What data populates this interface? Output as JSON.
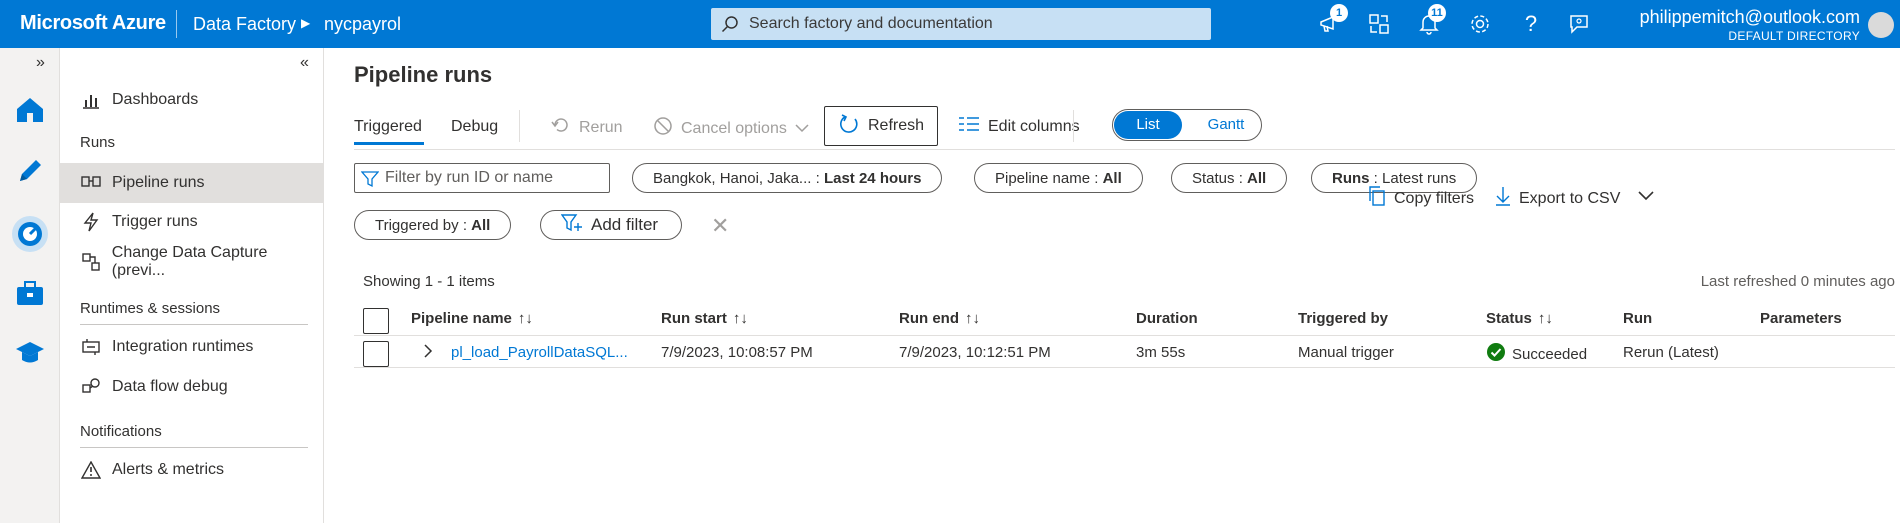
{
  "topbar": {
    "brand": "Microsoft Azure",
    "breadcrumb": [
      "Data Factory",
      "nycpayrol"
    ],
    "search_placeholder": "Search factory and documentation",
    "announcement_count": "1",
    "notification_count": "11",
    "user_email": "philippemitch@outlook.com",
    "user_directory": "DEFAULT DIRECTORY",
    "accent": "#0078d4"
  },
  "nav": {
    "dashboards": "Dashboards",
    "section_runs": "Runs",
    "pipeline_runs": "Pipeline runs",
    "trigger_runs": "Trigger runs",
    "change_data_capture": "Change Data Capture (previ...",
    "section_runtimes": "Runtimes & sessions",
    "integration_runtimes": "Integration runtimes",
    "data_flow_debug": "Data flow debug",
    "section_notifications": "Notifications",
    "alerts_metrics": "Alerts & metrics"
  },
  "page": {
    "title": "Pipeline runs",
    "tabs": [
      "Triggered",
      "Debug"
    ],
    "toolbar": {
      "rerun": "Rerun",
      "cancel_options": "Cancel options",
      "refresh": "Refresh",
      "edit_columns": "Edit columns",
      "view_list": "List",
      "view_gantt": "Gantt"
    },
    "filters": {
      "search_placeholder": "Filter by run ID or name",
      "timezone": "Bangkok, Hanoi, Jaka...",
      "time_range": "Last 24 hours",
      "pipeline_name_label": "Pipeline name",
      "pipeline_name_value": "All",
      "status_label": "Status",
      "status_value": "All",
      "runs_label": "Runs",
      "runs_value": "Latest runs",
      "triggered_by_label": "Triggered by",
      "triggered_by_value": "All",
      "add_filter": "Add filter",
      "copy_filters": "Copy filters",
      "export_csv": "Export to CSV"
    },
    "showing": "Showing 1 - 1 items",
    "last_refreshed": "Last refreshed 0 minutes ago",
    "columns": [
      "Pipeline name",
      "Run start",
      "Run end",
      "Duration",
      "Triggered by",
      "Status",
      "Run",
      "Parameters"
    ],
    "rows": [
      {
        "pipeline_name": "pl_load_PayrollDataSQL...",
        "run_start": "7/9/2023, 10:08:57 PM",
        "run_end": "7/9/2023, 10:12:51 PM",
        "duration": "3m 55s",
        "triggered_by": "Manual trigger",
        "status": "Succeeded",
        "run": "Rerun (Latest)",
        "parameters": ""
      }
    ]
  }
}
